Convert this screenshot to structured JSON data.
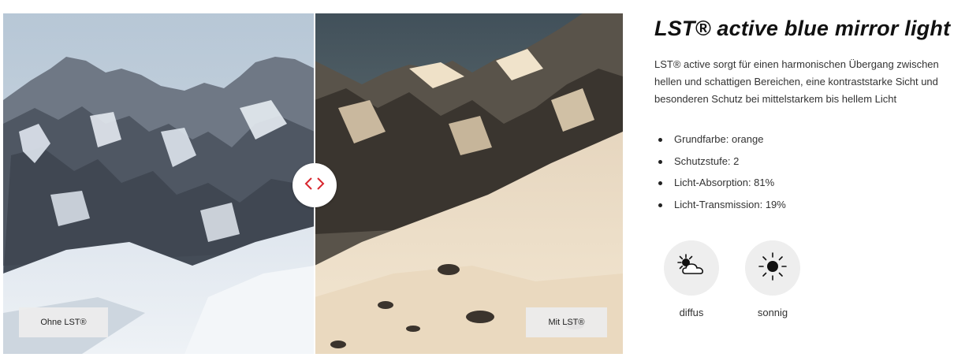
{
  "comparison": {
    "label_without": "Ohne LST®",
    "label_with": "Mit LST®",
    "handle_icon": "chevron-left-right-icon",
    "colors": {
      "handle_chevrons": "#d8262e"
    }
  },
  "product": {
    "title": "LST® active blue mirror light",
    "description": "LST® active sorgt für einen harmonischen Übergang zwischen hellen und schattigen Bereichen, eine kontraststarke Sicht und besonderen Schutz bei mittelstarkem bis hellem Licht",
    "specs": [
      "Grundfarbe: orange",
      "Schutzstufe: 2",
      "Licht-Absorption: 81%",
      "Licht-Transmission: 19%"
    ]
  },
  "conditions": [
    {
      "label": "diffus",
      "icon": "sun-behind-cloud-icon"
    },
    {
      "label": "sonnig",
      "icon": "sun-icon"
    }
  ]
}
